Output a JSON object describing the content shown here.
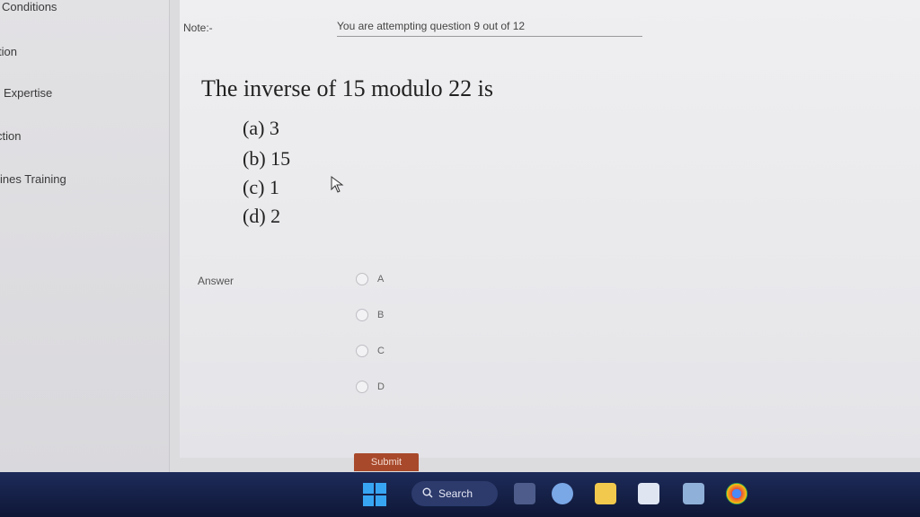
{
  "sidebar": {
    "items": [
      {
        "label": "Conditions"
      },
      {
        "label": "tion"
      },
      {
        "label": "Expertise"
      },
      {
        "label": "ction"
      },
      {
        "label": "ines Training"
      }
    ]
  },
  "header": {
    "note_label": "Note:-",
    "attempt_text": "You are attempting question 9 out of 12"
  },
  "question": {
    "text": "The inverse of 15 modulo 22 is",
    "options": [
      {
        "label": "(a) 3"
      },
      {
        "label": "(b) 15"
      },
      {
        "label": "(c) 1"
      },
      {
        "label": "(d) 2"
      }
    ]
  },
  "answer": {
    "label": "Answer",
    "choices": [
      {
        "label": "A"
      },
      {
        "label": "B"
      },
      {
        "label": "C"
      },
      {
        "label": "D"
      }
    ]
  },
  "submit": {
    "label": "Submit"
  },
  "taskbar": {
    "search_label": "Search",
    "colors": {
      "accent": "#38a5f3",
      "submit": "#a8492b"
    }
  }
}
